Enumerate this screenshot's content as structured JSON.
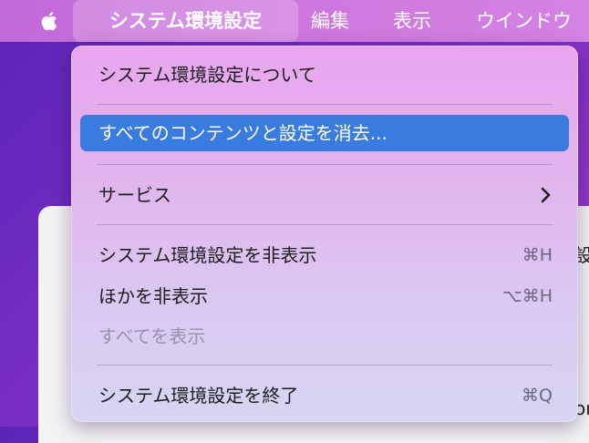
{
  "menubar": {
    "apple_icon": "apple-logo-icon",
    "app_menu": "システム環境設定",
    "menus": [
      "編集",
      "表示",
      "ウインドウ"
    ]
  },
  "dropdown": {
    "items": [
      {
        "label": "システム環境設定について",
        "shortcut": "",
        "enabled": true
      },
      {
        "label": "すべてのコンテンツと設定を消去...",
        "shortcut": "",
        "enabled": true,
        "highlighted": true
      },
      {
        "label": "サービス",
        "shortcut": "",
        "enabled": true,
        "submenu": true
      },
      {
        "label": "システム環境設定を非表示",
        "shortcut": "⌘H",
        "enabled": true
      },
      {
        "label": "ほかを非表示",
        "shortcut": "⌥⌘H",
        "enabled": true
      },
      {
        "label": "すべてを表示",
        "shortcut": "",
        "enabled": false
      },
      {
        "label": "システム環境設定を終了",
        "shortcut": "⌘Q",
        "enabled": true
      }
    ]
  },
  "background_window": {
    "edge_text_top": "設",
    "edge_text_bottom": "on"
  },
  "colors": {
    "highlight": "#3a7be0",
    "menubar": "#cf78df"
  }
}
